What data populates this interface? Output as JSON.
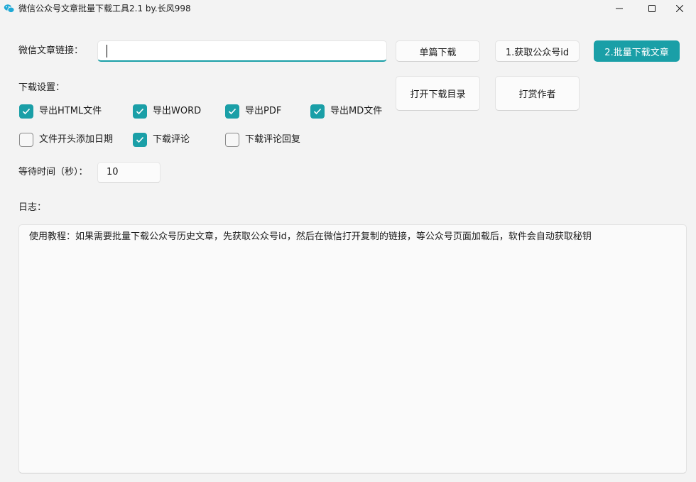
{
  "window": {
    "title": "微信公众号文章批量下载工具2.1 by.长风998",
    "icon": "wechat-icon",
    "accent": "#1a9fa7"
  },
  "form": {
    "url_label": "微信文章链接：",
    "url_value": "",
    "single_download_button": "单篇下载",
    "get_id_button": "1.获取公众号id",
    "batch_download_button": "2.批量下载文章",
    "open_dir_button": "打开下载目录",
    "tip_author_button": "打赏作者"
  },
  "settings": {
    "label": "下载设置：",
    "options": [
      {
        "label": "导出HTML文件",
        "checked": true
      },
      {
        "label": "导出WORD",
        "checked": true
      },
      {
        "label": "导出PDF",
        "checked": true
      },
      {
        "label": "导出MD文件",
        "checked": true
      },
      {
        "label": "文件开头添加日期",
        "checked": false
      },
      {
        "label": "下载评论",
        "checked": true
      },
      {
        "label": "下载评论回复",
        "checked": false
      }
    ],
    "wait_label": "等待时间（秒）：",
    "wait_value": "10"
  },
  "log": {
    "label": "日志：",
    "text": "使用教程：如果需要批量下载公众号历史文章，先获取公众号id，然后在微信打开复制的链接，等公众号页面加载后，软件会自动获取秘钥"
  }
}
